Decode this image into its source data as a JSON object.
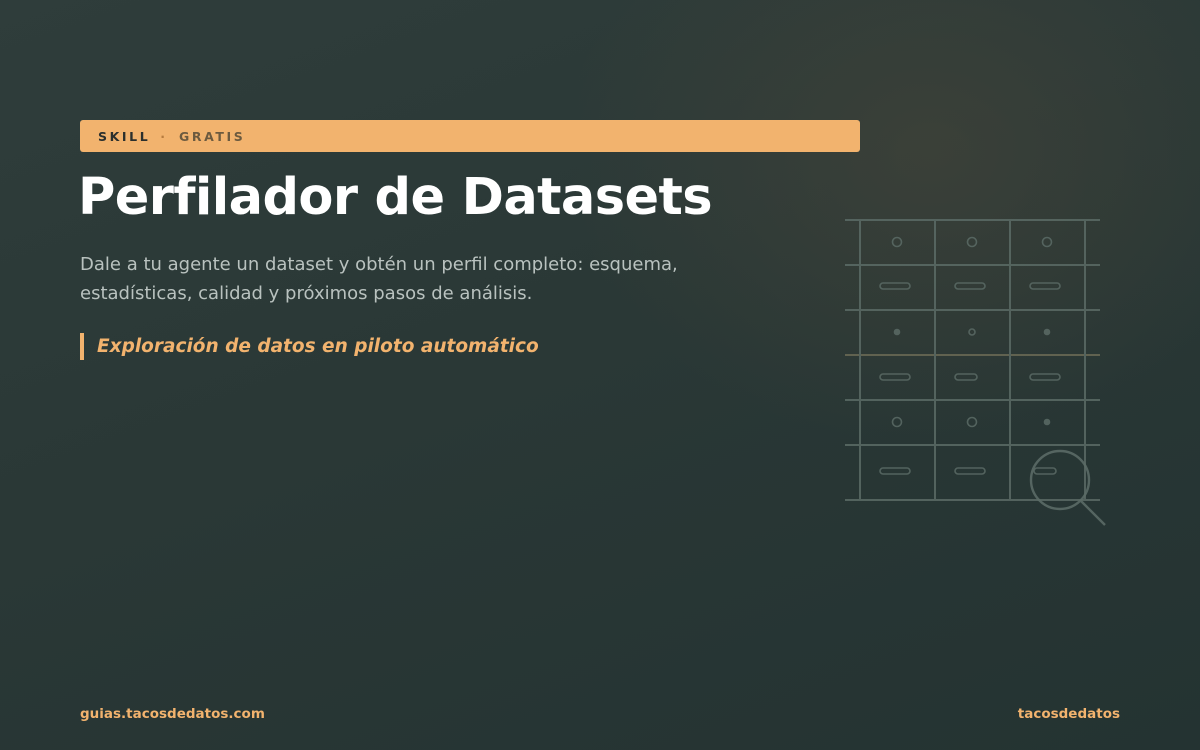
{
  "banner": {
    "label": "SKILL",
    "separator": "·",
    "tag": "GRATIS"
  },
  "title": "Perfilador de Datasets",
  "description": "Dale a tu agente un dataset y obtén un perfil completo: esquema, estadísticas, calidad y próximos pasos de análisis.",
  "tagline": "Exploración de datos en piloto automático",
  "footer": {
    "url": "guias.tacosdedatos.com",
    "brand": "tacosdedatos"
  },
  "colors": {
    "accent": "#f2b36e",
    "background": "#2a3836",
    "title": "#ffffff",
    "body_text": "#b9c2bf",
    "illustration_stroke": "#5b6b66"
  },
  "illustration": {
    "icon": "data-table-magnifier-icon"
  }
}
